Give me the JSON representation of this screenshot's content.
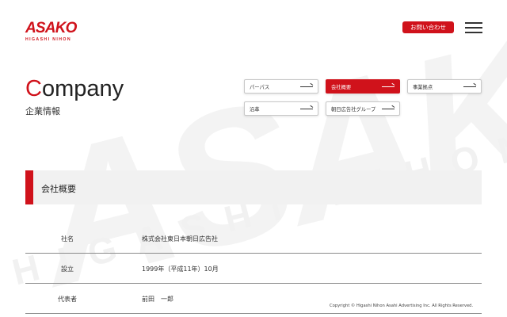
{
  "brand": {
    "logo_main": "ASAKO",
    "logo_sub": "HIGASHI NIHON",
    "watermark_main": "ASAKO",
    "watermark_sub": "HIGASHI NIHON",
    "accent_color": "#d0121b"
  },
  "header": {
    "contact_label": "お問い合わせ",
    "menu_icon": "hamburger-menu-icon"
  },
  "page_heading": {
    "first_letter": "C",
    "rest": "ompany",
    "subtitle": "企業情報"
  },
  "nav": {
    "items": [
      {
        "label": "パーパス",
        "active": false
      },
      {
        "label": "会社概要",
        "active": true
      },
      {
        "label": "事業拠点",
        "active": false
      },
      {
        "label": "沿革",
        "active": false
      },
      {
        "label": "朝日広告社グループ",
        "active": false
      }
    ],
    "arrow_icon": "long-arrow-right-icon"
  },
  "section": {
    "title": "会社概要"
  },
  "company_info": [
    {
      "label": "社名",
      "value": "株式会社東日本朝日広告社"
    },
    {
      "label": "設立",
      "value": "1999年（平成11年）10月"
    },
    {
      "label": "代表者",
      "value": "前田　一郎"
    }
  ],
  "footer": {
    "copyright": "Copyright © Higashi Nihon Asahi Advertising Inc. All Rights Reserved."
  }
}
